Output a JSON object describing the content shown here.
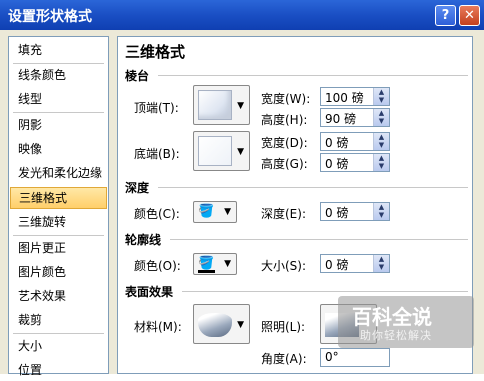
{
  "window": {
    "title": "设置形状格式",
    "help_glyph": "?",
    "close_glyph": "✕"
  },
  "sidebar": {
    "items": [
      {
        "label": "填充"
      },
      {
        "label": "线条颜色"
      },
      {
        "label": "线型"
      },
      {
        "label": "阴影"
      },
      {
        "label": "映像"
      },
      {
        "label": "发光和柔化边缘"
      },
      {
        "label": "三维格式",
        "selected": true
      },
      {
        "label": "三维旋转"
      },
      {
        "label": "图片更正"
      },
      {
        "label": "图片颜色"
      },
      {
        "label": "艺术效果"
      },
      {
        "label": "裁剪"
      },
      {
        "label": "大小"
      },
      {
        "label": "位置"
      }
    ]
  },
  "content": {
    "heading": "三维格式",
    "bevel": {
      "section": "棱台",
      "top_label": "顶端(T):",
      "bottom_label": "底端(B):",
      "top_width_label": "宽度(W):",
      "top_width": "100 磅",
      "top_height_label": "高度(H):",
      "top_height": "90 磅",
      "bottom_width_label": "宽度(D):",
      "bottom_width": "0 磅",
      "bottom_height_label": "高度(G):",
      "bottom_height": "0 磅"
    },
    "depth": {
      "section": "深度",
      "color_label": "颜色(C):",
      "depth_label": "深度(E):",
      "depth_value": "0 磅"
    },
    "contour": {
      "section": "轮廓线",
      "color_label": "颜色(O):",
      "size_label": "大小(S):",
      "size_value": "0 磅"
    },
    "surface": {
      "section": "表面效果",
      "material_label": "材料(M):",
      "lighting_label": "照明(L):",
      "angle_label": "角度(A):",
      "angle_value": "0°"
    }
  },
  "watermark": {
    "title": "百科全说",
    "subtitle": "助你轻松解决"
  },
  "colors": {
    "title_bar": "#1a4fc4",
    "selected_item": "#ffcf6a",
    "dialog_bg": "#ece9d8"
  }
}
